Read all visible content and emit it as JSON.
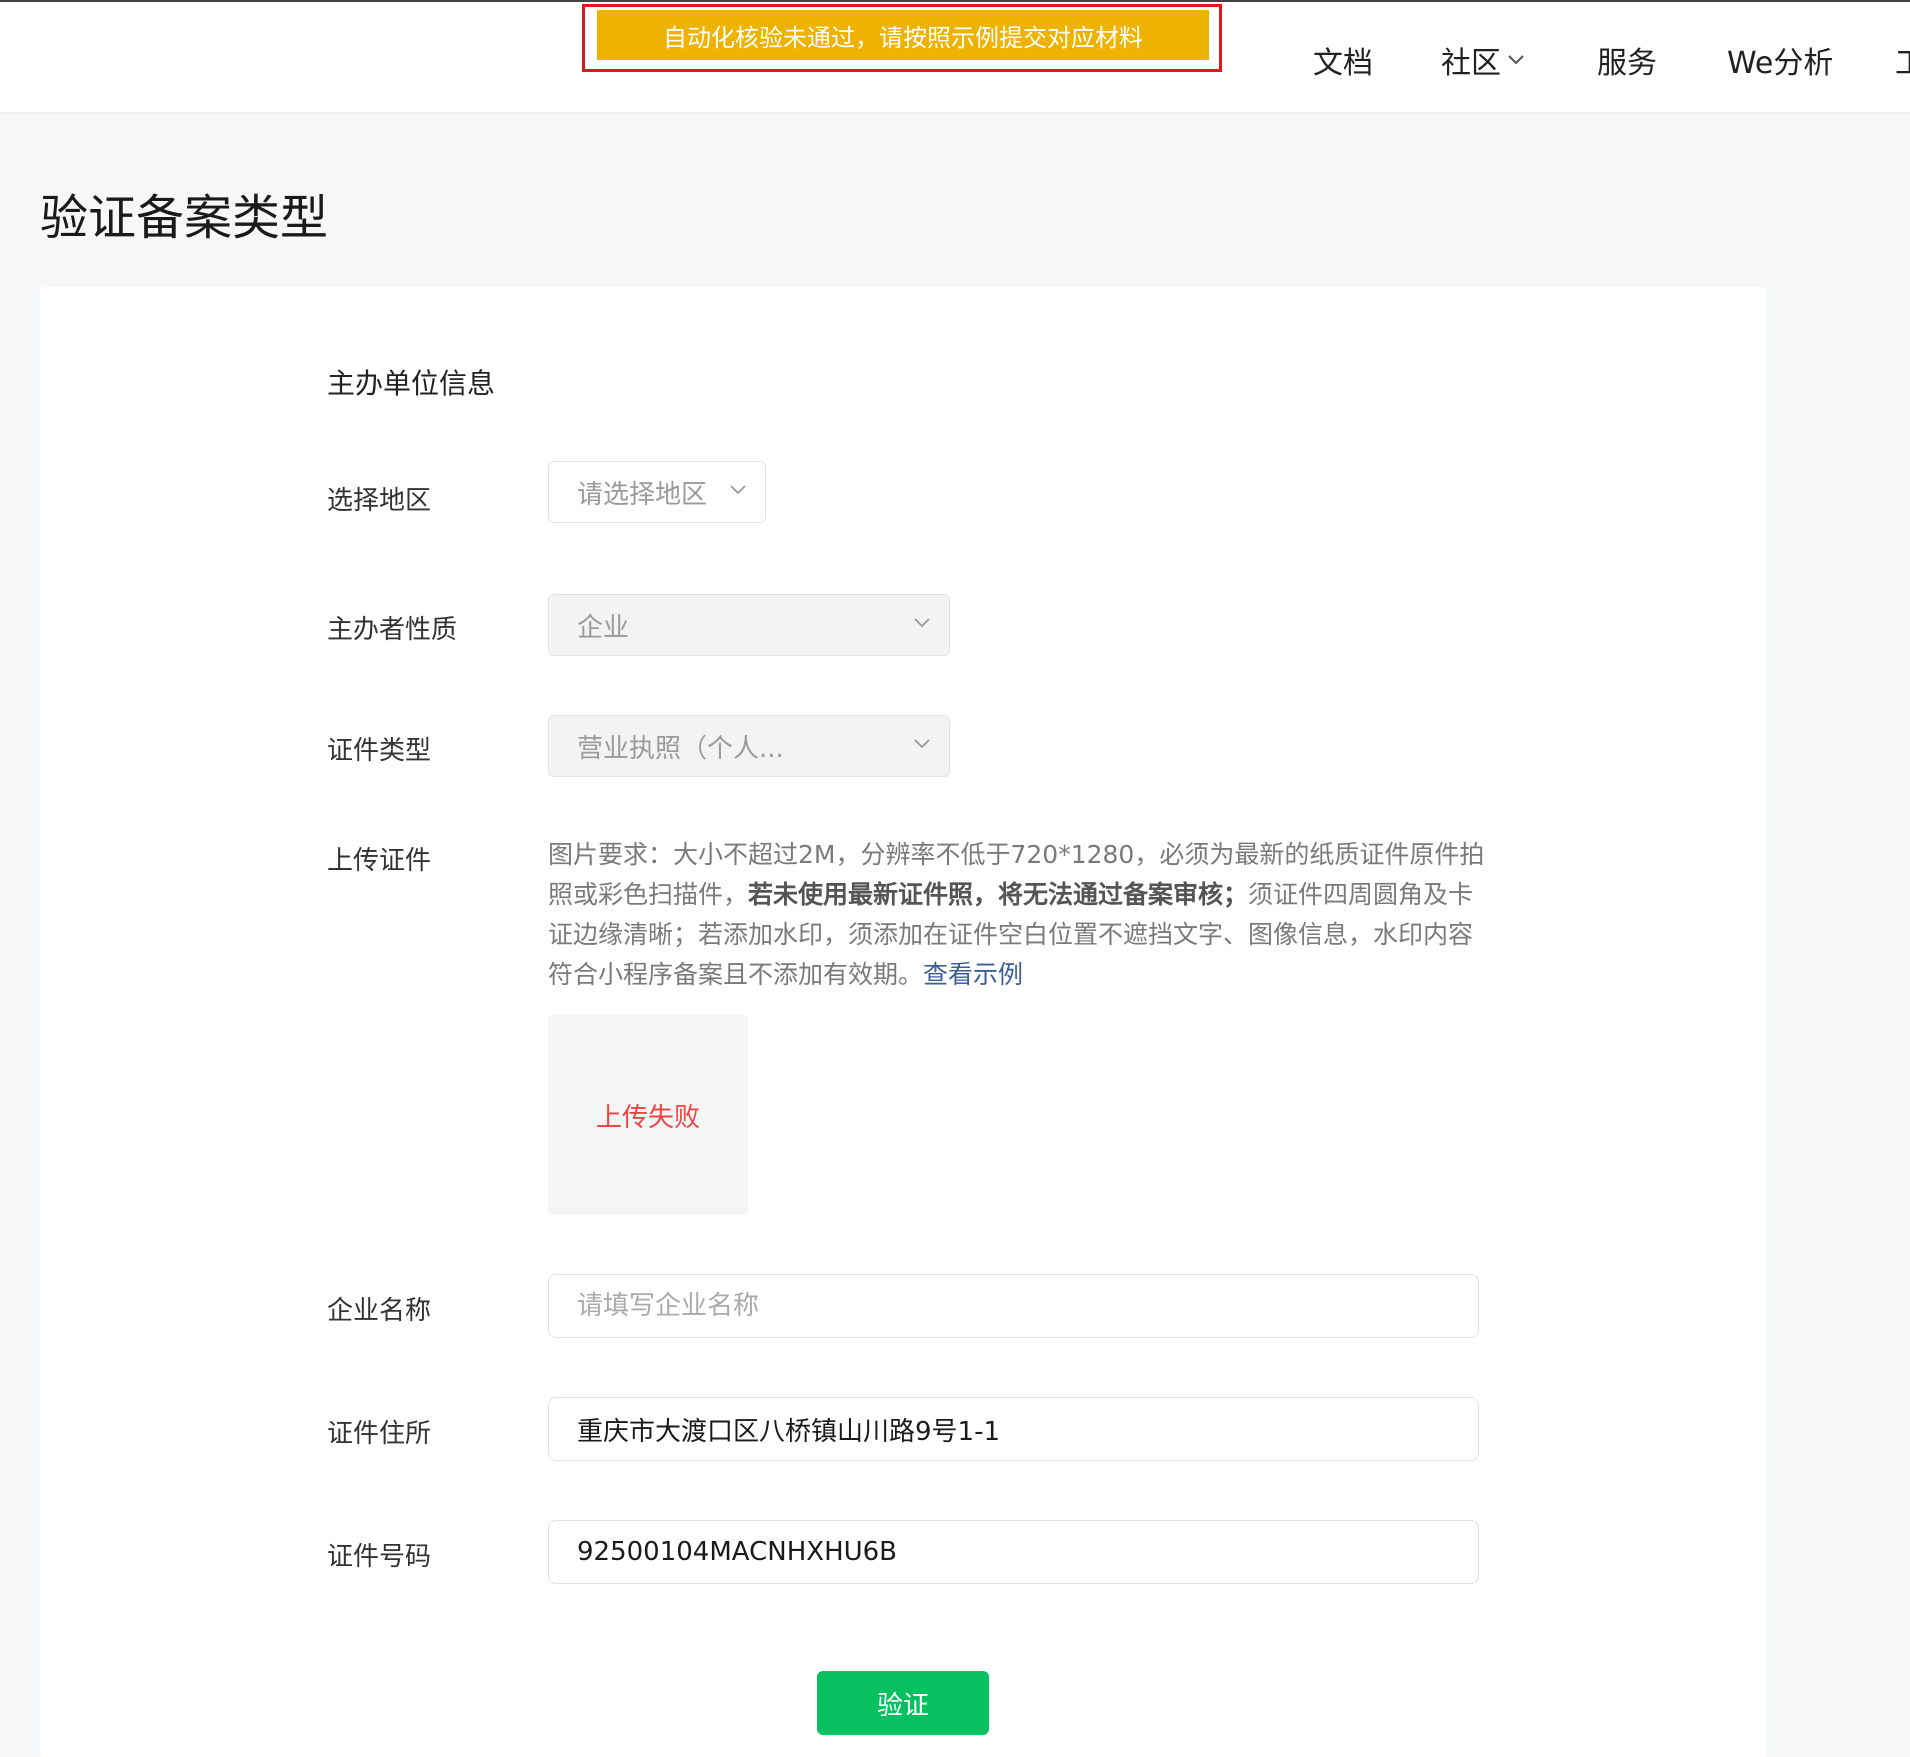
{
  "header": {
    "alert_text": "自动化核验未通过，请按照示例提交对应材料",
    "nav": [
      {
        "label": "文档"
      },
      {
        "label": "社区"
      },
      {
        "label": "服务"
      },
      {
        "label": "We分析"
      },
      {
        "label": "工"
      }
    ]
  },
  "page": {
    "title": "验证备案类型"
  },
  "form": {
    "section_title": "主办单位信息",
    "region": {
      "label": "选择地区",
      "placeholder": "请选择地区"
    },
    "organizer_type": {
      "label": "主办者性质",
      "value": "企业"
    },
    "cert_type": {
      "label": "证件类型",
      "value": "营业执照（个人..."
    },
    "upload": {
      "label": "上传证件",
      "desc_part1": "图片要求：大小不超过2M，分辨率不低于720*1280，必须为最新的纸质证件原件拍照或彩色扫描件，",
      "desc_bold": "若未使用最新证件照，将无法通过备案审核；",
      "desc_part2": "须证件四周圆角及卡证边缘清晰；若添加水印，须添加在证件空白位置不遮挡文字、图像信息，水印内容符合小程序备案且不添加有效期。",
      "example_link": "查看示例",
      "status": "上传失败"
    },
    "company_name": {
      "label": "企业名称",
      "placeholder": "请填写企业名称",
      "value": ""
    },
    "cert_address": {
      "label": "证件住所",
      "value": "重庆市大渡口区八桥镇山川路9号1-1"
    },
    "cert_number": {
      "label": "证件号码",
      "value": "92500104MACNHXHU6B"
    },
    "submit_label": "验证"
  },
  "colors": {
    "alert_bg": "#eeb300",
    "alert_border": "#e5151b",
    "primary_button": "#07c160",
    "error_text": "#f04444",
    "link": "#3b5f95"
  }
}
